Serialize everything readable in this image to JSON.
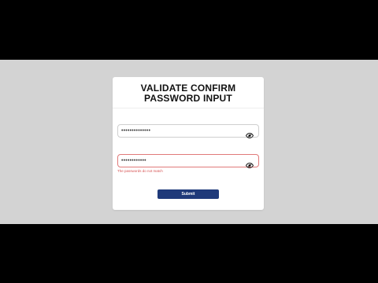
{
  "form": {
    "title": "VALIDATE CONFIRM PASSWORD INPUT",
    "password_mask": "••••••••••••••",
    "confirm_password_mask": "••••••••••••",
    "error_message": "The passwords do not match",
    "submit_label": "Submit"
  },
  "icons": {
    "toggle_visibility": "eye-slash"
  },
  "colors": {
    "page_background": "#d3d3d3",
    "letterbox": "#000000",
    "card": "#ffffff",
    "button": "#1f3a7a",
    "error": "#d65353"
  }
}
